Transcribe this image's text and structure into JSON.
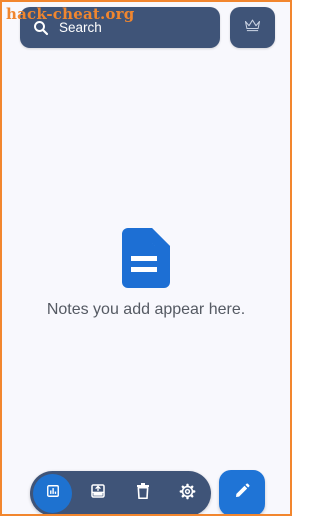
{
  "watermark": "hack-cheat.org",
  "search": {
    "label": "Search",
    "icon": "search-icon"
  },
  "premium": {
    "icon": "crown-icon"
  },
  "empty_state": {
    "icon": "document-icon",
    "message": "Notes you add appear here."
  },
  "bottom_bar": {
    "items": [
      {
        "icon": "chart-icon",
        "active": true
      },
      {
        "icon": "archive-icon",
        "active": false
      },
      {
        "icon": "trash-icon",
        "active": false
      },
      {
        "icon": "settings-icon",
        "active": false
      }
    ]
  },
  "fab": {
    "icon": "pencil-icon"
  },
  "colors": {
    "accent": "#1f74d6",
    "bar": "#3f5478",
    "background": "#f8f8fd",
    "frame": "#f2862e",
    "text_muted": "#555a63"
  }
}
